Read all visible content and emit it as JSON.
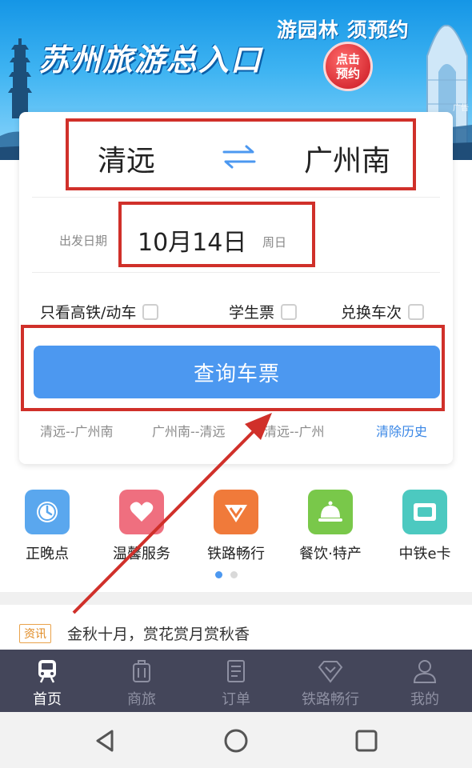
{
  "banner": {
    "title": "苏州旅游总入口",
    "slogan": "游园林 须预约",
    "badge_line1": "点击",
    "badge_line2": "预约",
    "ad_label": "广告"
  },
  "search": {
    "from_station": "清远",
    "to_station": "广州南",
    "date_label": "出发日期",
    "date_value": "10月14日",
    "weekday": "周日",
    "options": [
      {
        "label": "只看高铁/动车",
        "checked": false
      },
      {
        "label": "学生票",
        "checked": false
      },
      {
        "label": "兑换车次",
        "checked": false
      }
    ],
    "query_button": "查询车票",
    "history": [
      "清远--广州南",
      "广州南--清远",
      "清远--广州"
    ],
    "clear_history": "清除历史"
  },
  "services": [
    {
      "label": "正晚点",
      "icon": "clock-icon",
      "color": "#5aa7ee"
    },
    {
      "label": "温馨服务",
      "icon": "heart-icon",
      "color": "#ef6f7f"
    },
    {
      "label": "铁路畅行",
      "icon": "rail-icon",
      "color": "#f07a3a"
    },
    {
      "label": "餐饮·特产",
      "icon": "dining-bell-icon",
      "color": "#79c84a"
    },
    {
      "label": "中铁e卡",
      "icon": "card-icon",
      "color": "#4cc9c0"
    }
  ],
  "news": {
    "tag": "资讯",
    "headline": "金秋十月，赏花赏月赏秋香"
  },
  "tabbar": [
    {
      "label": "首页",
      "icon": "train-icon",
      "active": true
    },
    {
      "label": "商旅",
      "icon": "luggage-icon",
      "active": false
    },
    {
      "label": "订单",
      "icon": "order-icon",
      "active": false
    },
    {
      "label": "铁路畅行",
      "icon": "diamond-icon",
      "active": false
    },
    {
      "label": "我的",
      "icon": "profile-icon",
      "active": false
    }
  ],
  "colors": {
    "primary": "#4c98f0",
    "highlight": "#d0302a",
    "tabbar": "#44465a"
  }
}
